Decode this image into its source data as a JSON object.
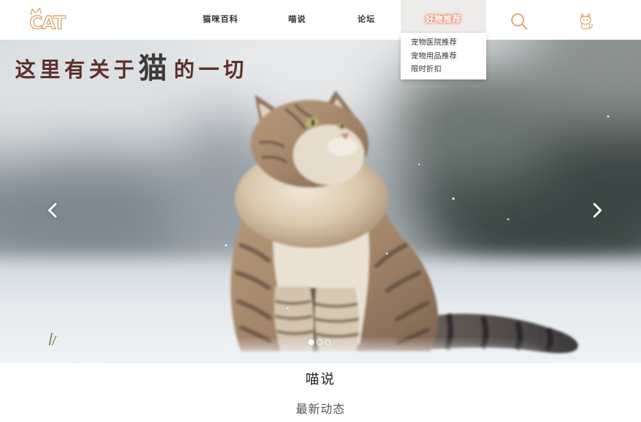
{
  "header": {
    "logo_text": "CAT",
    "logo_icon": "cat-ears-icon",
    "nav": [
      {
        "label": "猫咪百科",
        "active": false
      },
      {
        "label": "喵说",
        "active": false
      },
      {
        "label": "论坛",
        "active": false
      },
      {
        "label": "好物推荐",
        "active": true
      }
    ],
    "search_icon": "search-icon",
    "cat_icon": "cat-icon"
  },
  "dropdown": {
    "items": [
      {
        "label": "宠物医院推荐"
      },
      {
        "label": "宠物用品推荐"
      },
      {
        "label": "限时折扣"
      }
    ]
  },
  "hero": {
    "tagline_start": "这里有关于",
    "tagline_highlight": "猫",
    "tagline_end": "的一切",
    "prev_icon": "chevron-left-icon",
    "next_icon": "chevron-right-icon",
    "slide_count": 3,
    "active_slide_index": 0
  },
  "section": {
    "title": "喵说",
    "subtitle": "最新动态"
  },
  "colors": {
    "accent": "#dca66a",
    "nav_text": "#333333",
    "active_nav_bg": "#eeeceb",
    "active_nav_glow": "#e8825a",
    "tagline": "#5e2f2b",
    "tagline_highlight": "#3e3a39",
    "title_text": "#222222",
    "subtitle_text": "#555555"
  }
}
